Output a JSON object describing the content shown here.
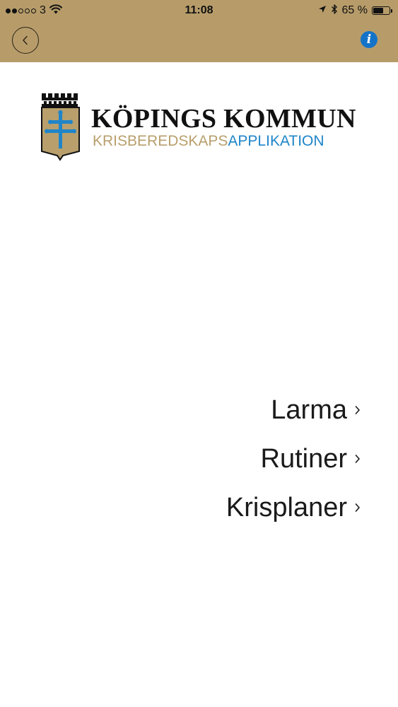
{
  "status_bar": {
    "carrier": "3",
    "signal_filled": 2,
    "signal_total": 5,
    "time": "11:08",
    "battery_percent_text": "65 %",
    "battery_level": 0.65,
    "icons": [
      "wifi-icon",
      "location-arrow-icon",
      "bluetooth-icon",
      "battery-icon"
    ]
  },
  "nav": {
    "back_icon": "chevron-left-icon",
    "info_label": "i"
  },
  "logo": {
    "title": "KÖPINGS KOMMUN",
    "subtitle_part1": "KRISBEREDSKAPS",
    "subtitle_part2": "APPLIKATION",
    "crest_icon": "coat-of-arms-icon"
  },
  "menu": {
    "items": [
      {
        "label": "Larma"
      },
      {
        "label": "Rutiner"
      },
      {
        "label": "Krisplaner"
      }
    ],
    "chevron_icon": "chevron-right-icon"
  },
  "colors": {
    "header": "#b79c6a",
    "info_blue": "#1473c9",
    "subtitle_gold": "#b89f6c",
    "subtitle_blue": "#1f85c9",
    "text": "#1a1a1a"
  }
}
